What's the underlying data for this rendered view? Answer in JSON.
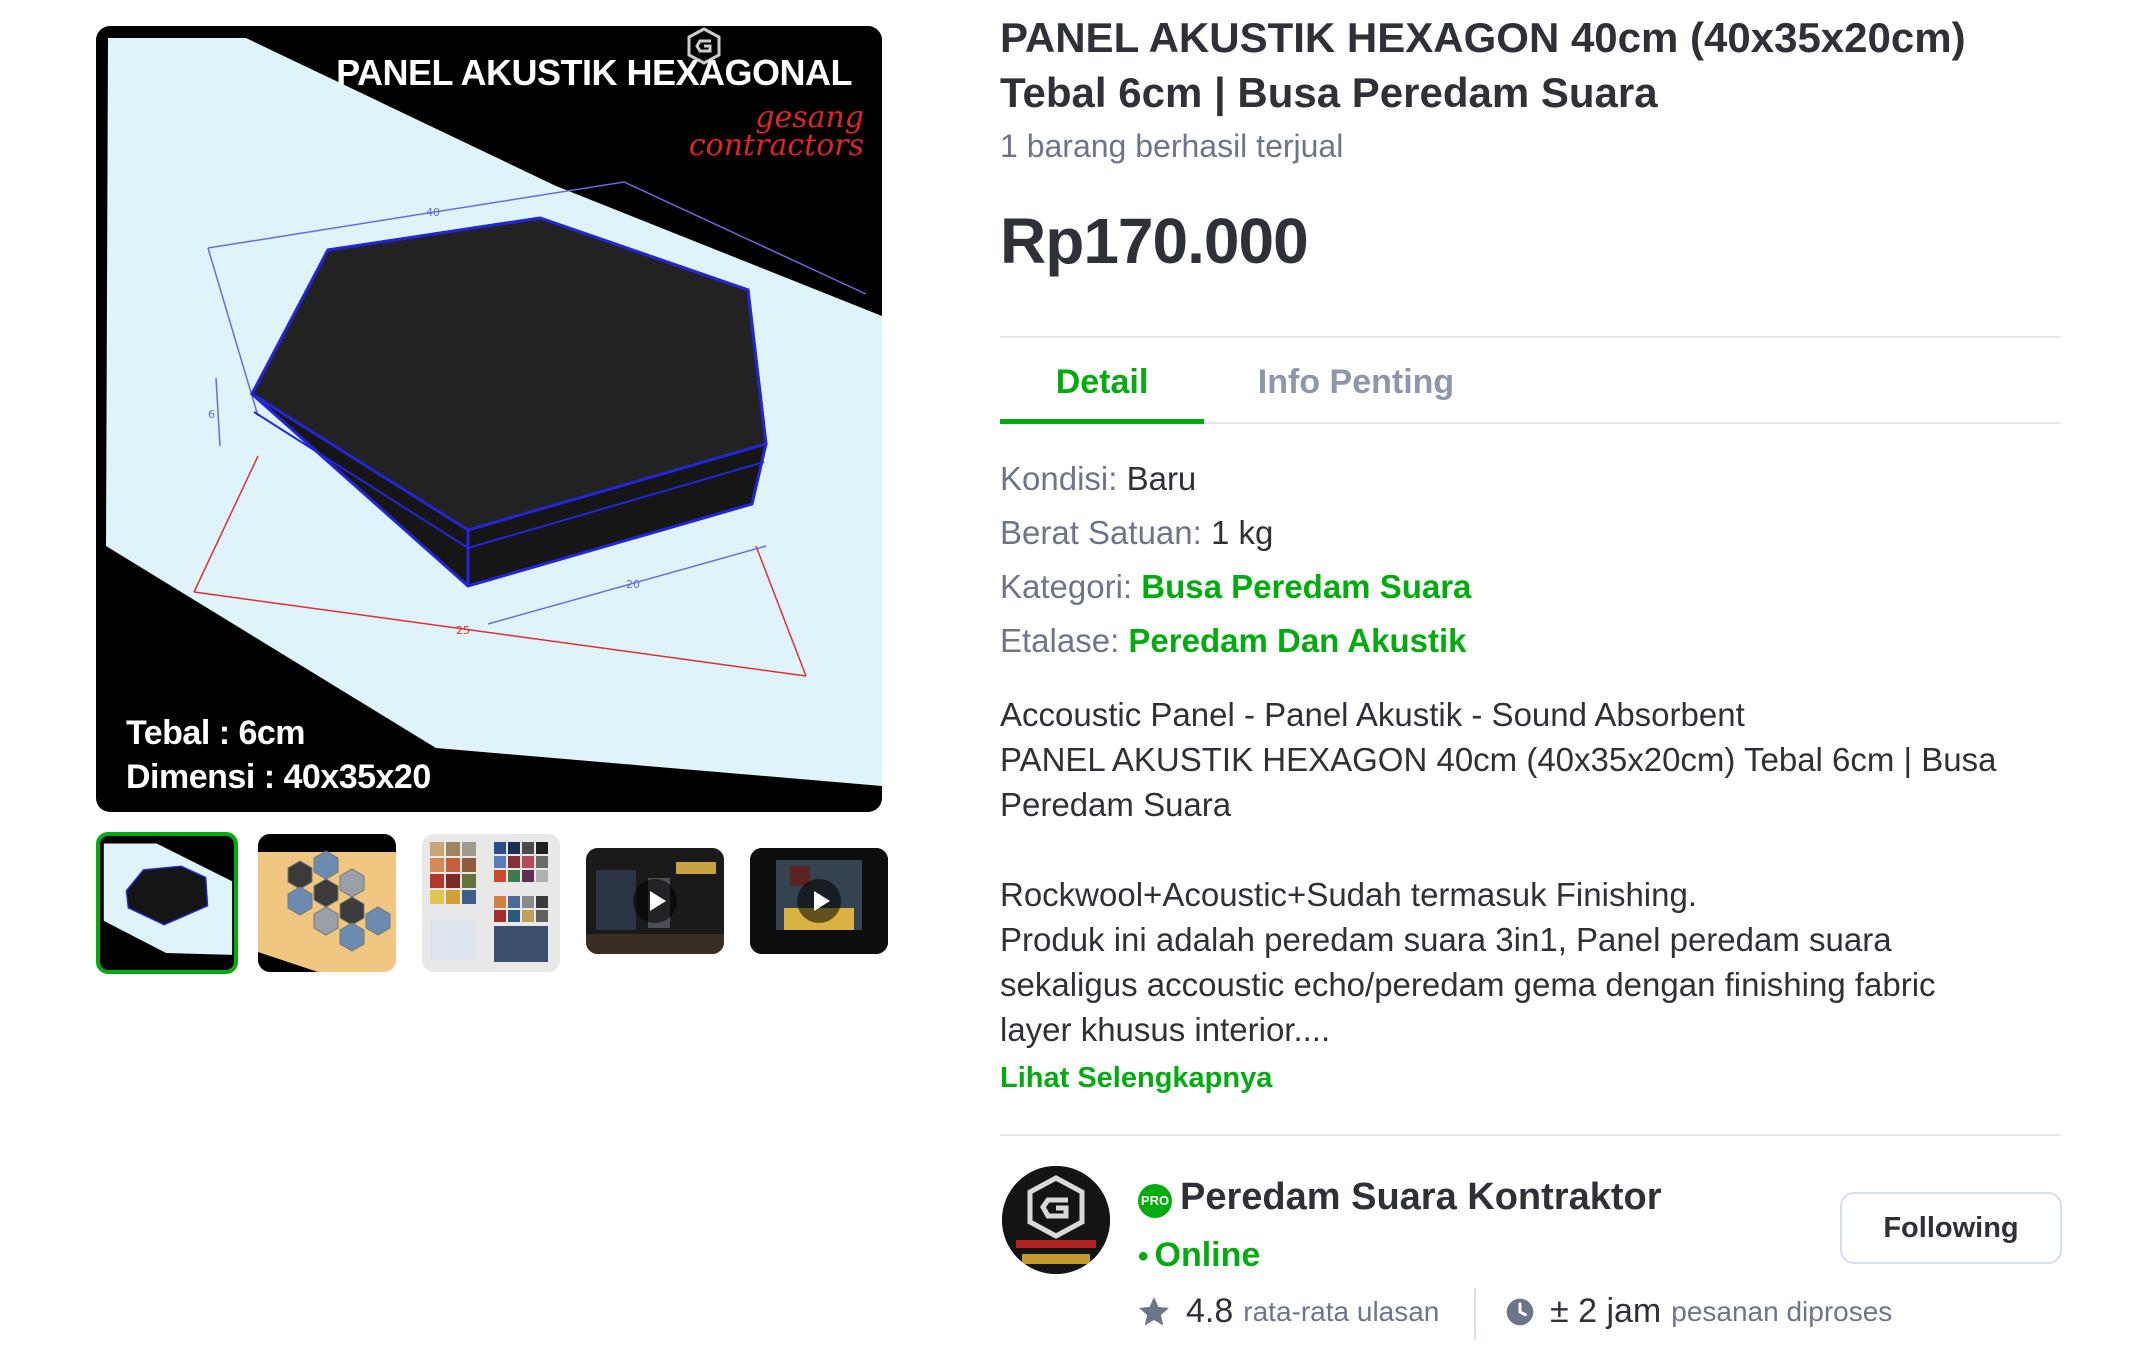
{
  "gallery": {
    "main_image": {
      "title": "PANEL AKUSTIK HEXAGONAL",
      "brand_line1": "gesang",
      "brand_line2": "contractors",
      "spec_thickness": "Tebal : 6cm",
      "spec_dimension": "Dimensi : 40x35x20",
      "dim_labels": [
        "40",
        "6",
        "20",
        "25"
      ]
    },
    "thumbnails": [
      {
        "kind": "image",
        "icon": "hexagon-panel-thumb"
      },
      {
        "kind": "image",
        "icon": "hexagon-pattern-thumb"
      },
      {
        "kind": "image",
        "icon": "color-swatch-thumb"
      },
      {
        "kind": "video",
        "icon": "play-icon"
      },
      {
        "kind": "video",
        "icon": "play-icon"
      }
    ]
  },
  "product": {
    "title": "PANEL AKUSTIK HEXAGON 40cm (40x35x20cm) Tebal 6cm | Busa Peredam Suara",
    "sold": "1 barang berhasil terjual",
    "price": "Rp170.000"
  },
  "tabs": [
    {
      "label": "Detail",
      "active": true
    },
    {
      "label": "Info Penting",
      "active": false
    }
  ],
  "specs": {
    "condition_label": "Kondisi: ",
    "condition_value": "Baru",
    "weight_label": "Berat Satuan: ",
    "weight_value": "1 kg",
    "category_label": "Kategori: ",
    "category_value": "Busa Peredam Suara",
    "showcase_label": "Etalase: ",
    "showcase_value": "Peredam Dan Akustik"
  },
  "description": {
    "line1": "Accoustic Panel - Panel Akustik - Sound Absorbent",
    "line2": "PANEL AKUSTIK HEXAGON 40cm (40x35x20cm) Tebal 6cm | Busa",
    "line3": "Peredam Suara",
    "line4": "Rockwool+Acoustic+Sudah termasuk Finishing.",
    "line5": "Produk ini adalah peredam suara 3in1, Panel peredam suara",
    "line6": "sekaligus accoustic echo/peredam gema dengan finishing fabric",
    "line7": "layer khusus interior....",
    "see_more": "Lihat Selengkapnya"
  },
  "shop": {
    "badge": "PRO",
    "name": "Peredam Suara Kontraktor",
    "status_dot": "•",
    "status": "Online",
    "follow_label": "Following",
    "rating": "4.8",
    "rating_label": "rata-rata ulasan",
    "process_time": "± 2 jam",
    "process_label": "pesanan diproses"
  },
  "colors": {
    "accent": "#03ac0e",
    "text_primary": "#2e3137",
    "text_secondary": "#6d7588",
    "image_sky": "#dff3fb"
  }
}
